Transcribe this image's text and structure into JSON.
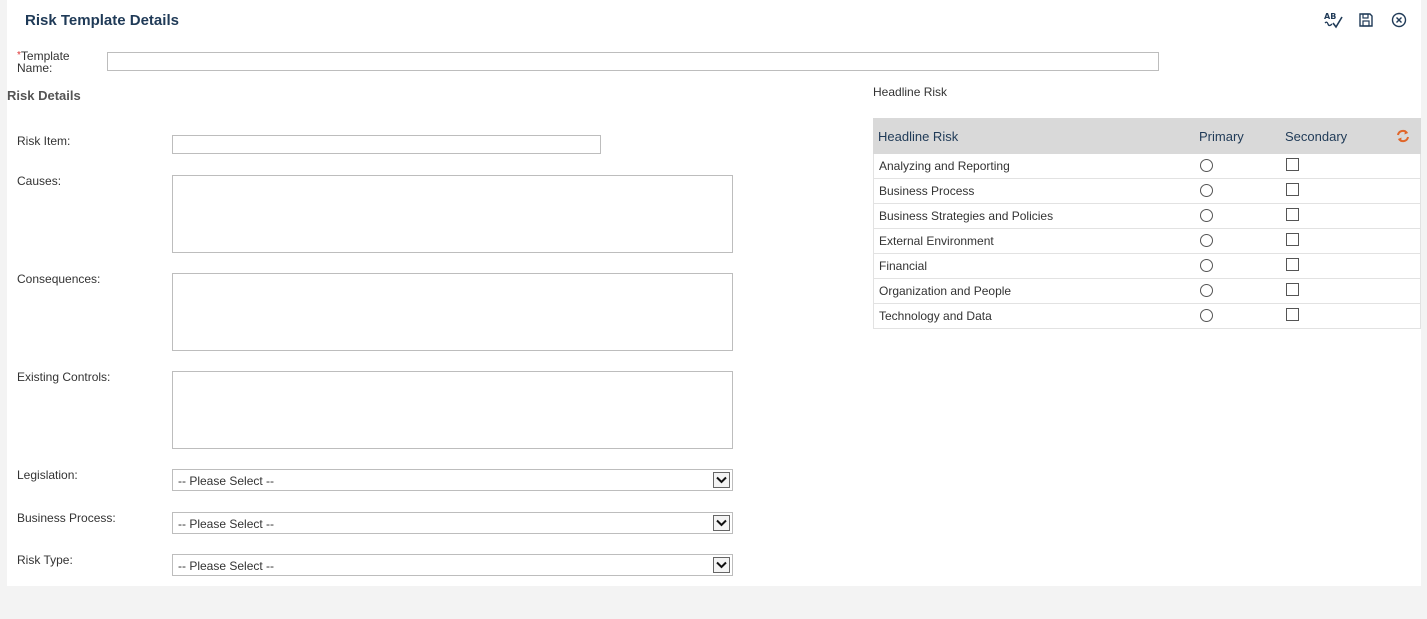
{
  "header": {
    "title": "Risk Template Details"
  },
  "toolbar": {
    "spellcheck_icon": "spellcheck-icon",
    "save_icon": "save-icon",
    "close_icon": "close-circle-icon"
  },
  "form": {
    "required_mark": "*",
    "template_name_label_1": "Template",
    "template_name_label_2": "Name:",
    "template_name_value": "",
    "section_title": "Risk Details",
    "risk_item_label": "Risk Item:",
    "risk_item_value": "",
    "causes_label": "Causes:",
    "consequences_label": "Consequences:",
    "existing_controls_label": "Existing Controls:",
    "legislation_label": "Legislation:",
    "legislation_value": "-- Please Select --",
    "business_process_label": "Business Process:",
    "business_process_value": "-- Please Select --",
    "risk_type_label": "Risk Type:",
    "risk_type_value": "-- Please Select --"
  },
  "headline": {
    "caption": "Headline Risk",
    "columns": {
      "name": "Headline Risk",
      "primary": "Primary",
      "secondary": "Secondary"
    },
    "rows": [
      {
        "name": "Analyzing and Reporting"
      },
      {
        "name": "Business Process"
      },
      {
        "name": "Business Strategies and Policies"
      },
      {
        "name": "External Environment"
      },
      {
        "name": "Financial"
      },
      {
        "name": "Organization and People"
      },
      {
        "name": "Technology and Data"
      }
    ]
  },
  "colors": {
    "title": "#1f3a57",
    "accent": "#e0662a",
    "grid_header": "#d9d9d9",
    "background": "#f3f3f3"
  }
}
